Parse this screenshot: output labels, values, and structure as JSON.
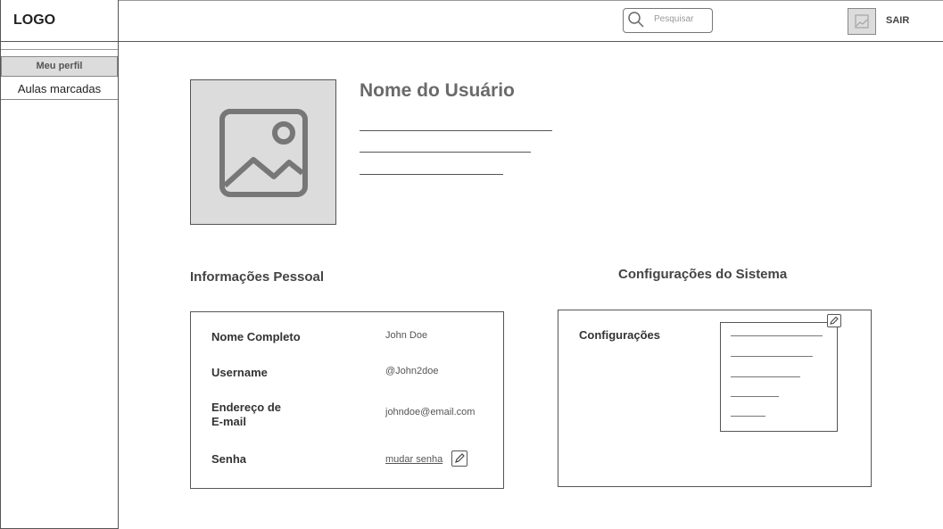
{
  "sidebar": {
    "logo": "LOGO",
    "items": [
      {
        "label": "Meu perfil"
      },
      {
        "label": "Aulas marcadas"
      }
    ]
  },
  "header": {
    "search_placeholder": "Pesquisar",
    "logout_label": "SAIR"
  },
  "profile": {
    "user_name": "Nome do Usuário"
  },
  "personal_info": {
    "title": "Informações Pessoal",
    "fields": [
      {
        "label": "Nome Completo",
        "value": "John Doe"
      },
      {
        "label": "Username",
        "value": "@John2doe"
      },
      {
        "label": "Endereço de\nE-mail",
        "value": "johndoe@email.com"
      },
      {
        "label": "Senha",
        "value": "mudar senha"
      }
    ]
  },
  "system_config": {
    "title": "Configurações do Sistema",
    "label": "Configurações"
  }
}
